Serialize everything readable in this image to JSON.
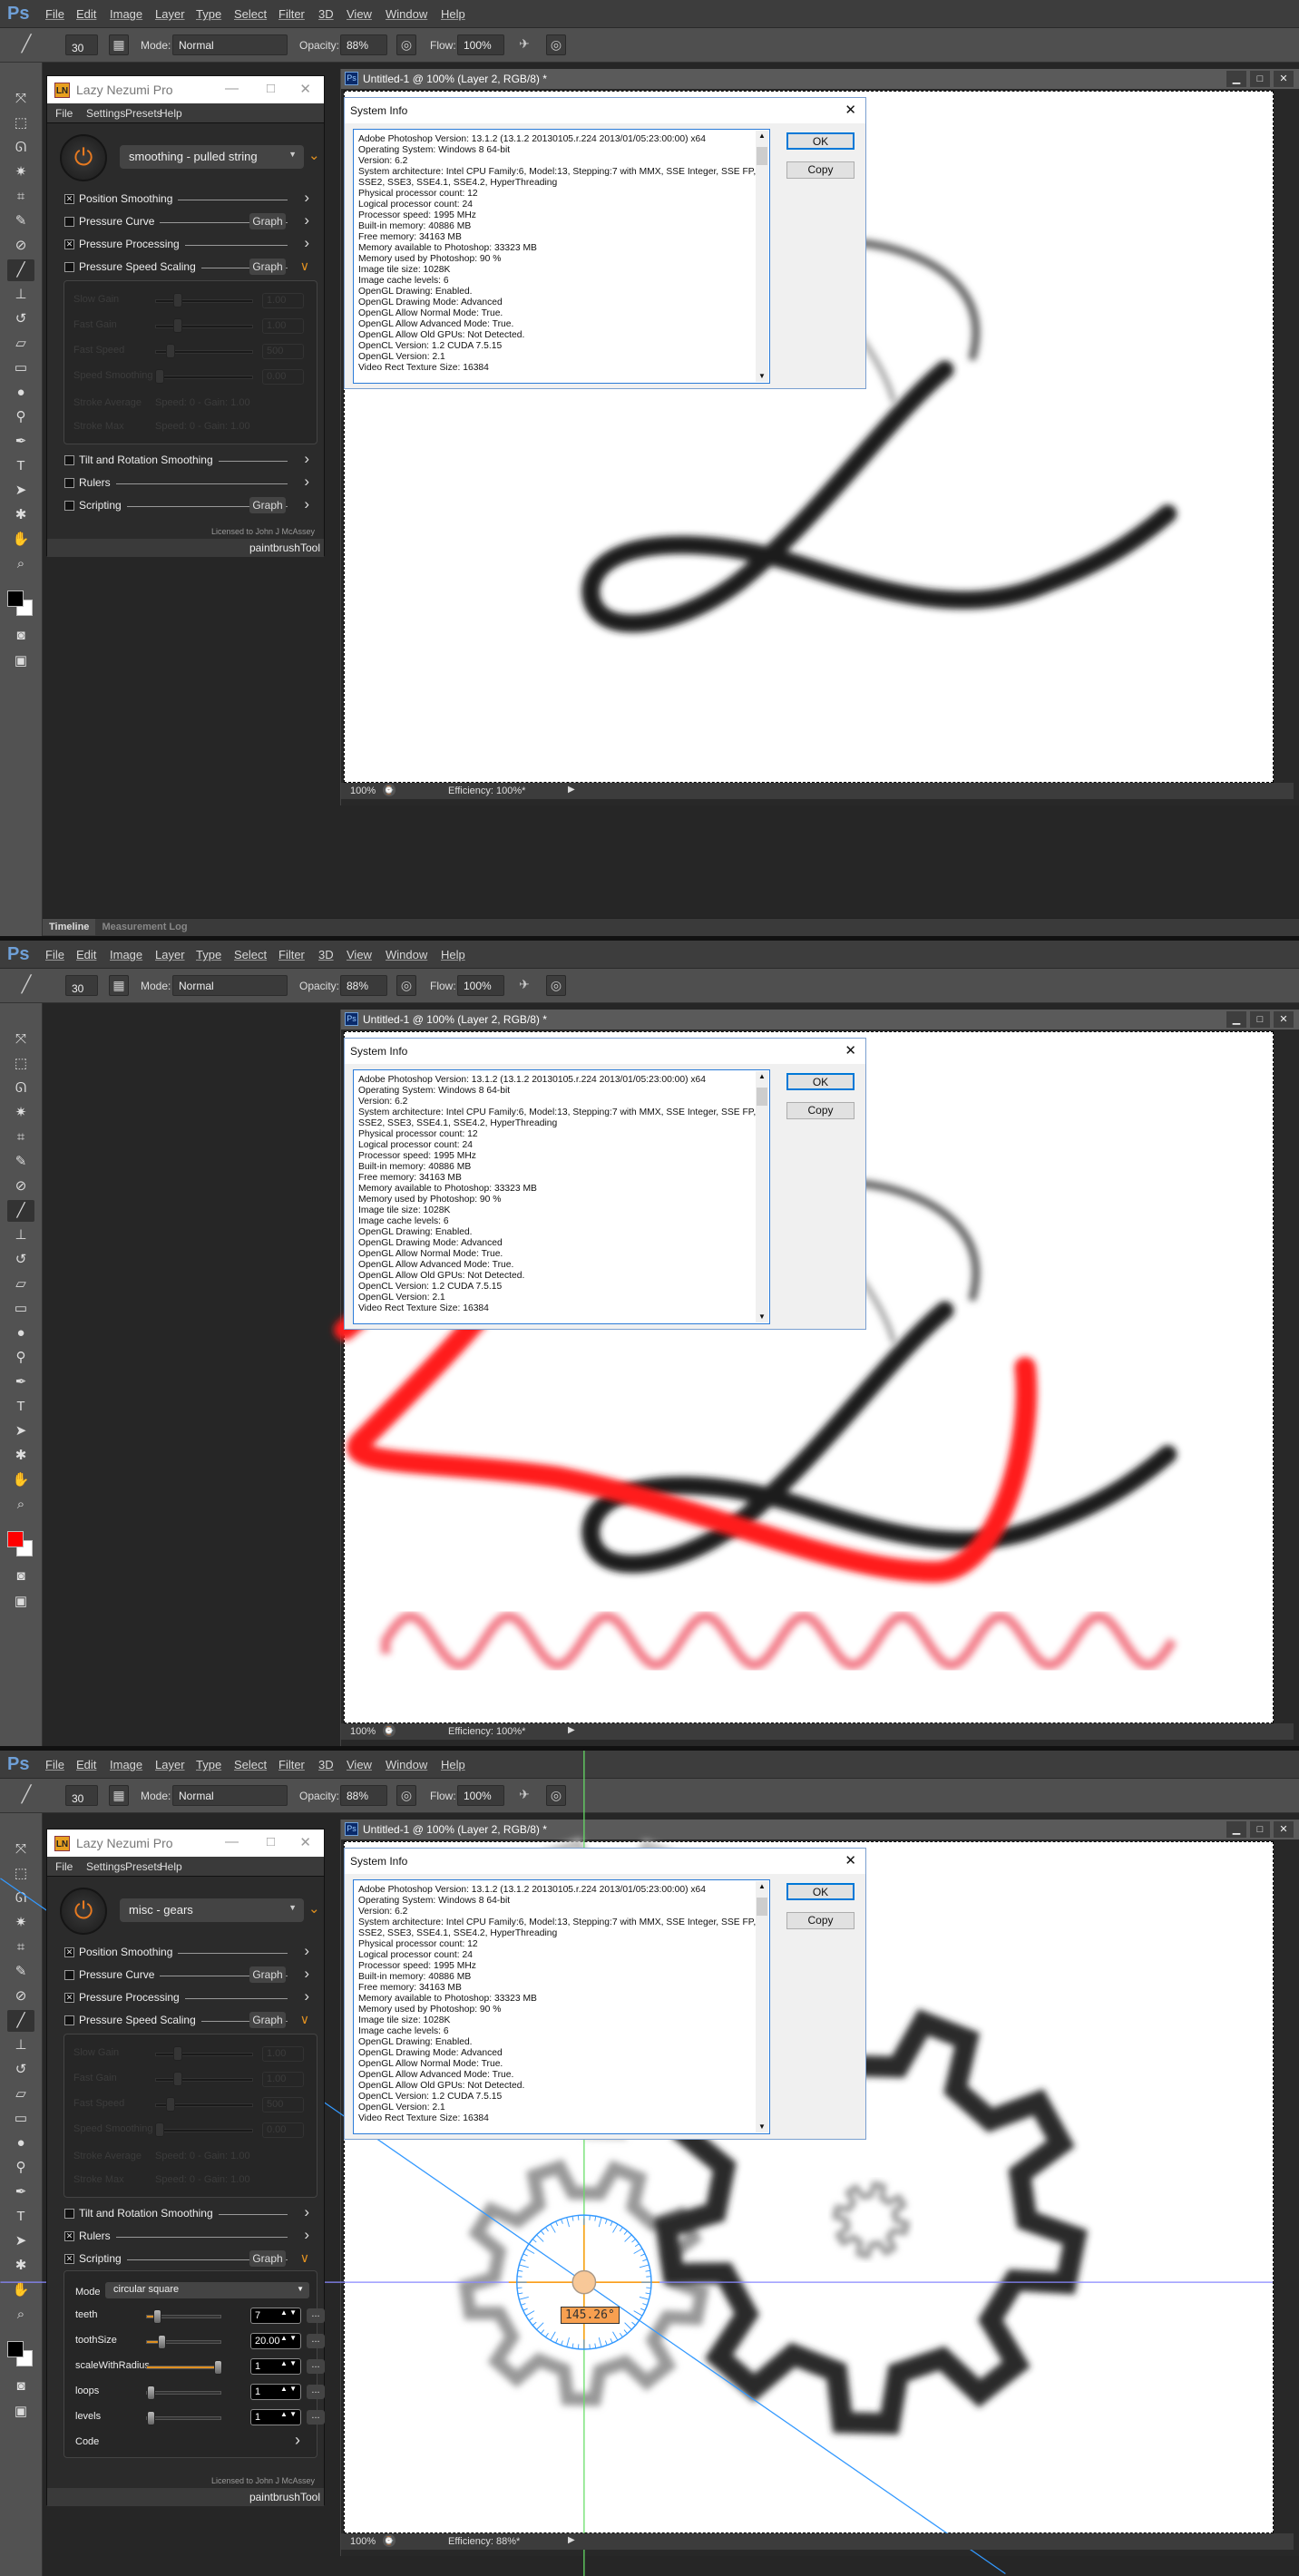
{
  "app": {
    "logo": "Ps",
    "menu": [
      "File",
      "Edit",
      "Image",
      "Layer",
      "Type",
      "Select",
      "Filter",
      "3D",
      "View",
      "Window",
      "Help"
    ]
  },
  "options_bar": {
    "brush_size": "30",
    "mode_label": "Mode:",
    "mode_value": "Normal",
    "opacity_label": "Opacity:",
    "opacity_value": "88%",
    "flow_label": "Flow:",
    "flow_value": "100%"
  },
  "document": {
    "title": "Untitled-1 @ 100% (Layer 2, RGB/8) *",
    "zoom": "100%"
  },
  "system_info": {
    "title": "System Info",
    "ok_label": "OK",
    "copy_label": "Copy",
    "lines": [
      "Adobe Photoshop Version: 13.1.2 (13.1.2 20130105.r.224 2013/01/05:23:00:00) x64",
      "Operating System: Windows 8 64-bit",
      "Version: 6.2",
      "System architecture: Intel CPU Family:6, Model:13, Stepping:7 with MMX, SSE Integer, SSE FP,",
      "SSE2, SSE3, SSE4.1, SSE4.2, HyperThreading",
      "Physical processor count: 12",
      "Logical processor count: 24",
      "Processor speed: 1995 MHz",
      "Built-in memory: 40886 MB",
      "Free memory: 34163 MB",
      "Memory available to Photoshop: 33323 MB",
      "Memory used by Photoshop: 90 %",
      "Image tile size: 1028K",
      "Image cache levels: 6",
      "OpenGL Drawing: Enabled.",
      "OpenGL Drawing Mode: Advanced",
      "OpenGL Allow Normal Mode: True.",
      "OpenGL Allow Advanced Mode: True.",
      "OpenGL Allow Old GPUs: Not Detected.",
      "OpenCL Version: 1.2 CUDA 7.5.15",
      "OpenGL Version: 2.1",
      "Video Rect Texture Size: 16384"
    ]
  },
  "plugin": {
    "title": "Lazy Nezumi Pro",
    "logo": "LN",
    "menu": [
      "File",
      "Settings",
      "Presets",
      "Help"
    ],
    "graph_label": "Graph",
    "license": "Licensed to John J McAssey",
    "footer": "paintbrushTool",
    "pressure_speed_box": {
      "sliders": [
        {
          "label": "Slow Gain",
          "value": "1.00",
          "level": 0.2
        },
        {
          "label": "Fast Gain",
          "value": "1.00",
          "level": 0.2
        },
        {
          "label": "Fast Speed",
          "value": "500",
          "level": 0.12
        },
        {
          "label": "Speed Smoothing",
          "value": "0.00",
          "level": 0
        }
      ],
      "stats": [
        {
          "label": "Stroke Average",
          "value": "Speed: 0 - Gain: 1.00"
        },
        {
          "label": "Stroke Max",
          "value": "Speed: 0 - Gain: 1.00"
        }
      ]
    }
  },
  "frames": [
    {
      "foreground_color": "#000000",
      "efficiency": "Efficiency: 100%*",
      "bottom_tabs": [
        "Timeline",
        "Measurement Log"
      ],
      "plugin": {
        "preset": "smoothing - pulled string",
        "rows": [
          {
            "label": "Position Smoothing",
            "checked": true,
            "graph": false,
            "expanded": false
          },
          {
            "label": "Pressure Curve",
            "checked": false,
            "graph": true,
            "expanded": false
          },
          {
            "label": "Pressure Processing",
            "checked": true,
            "graph": false,
            "expanded": false
          },
          {
            "label": "Pressure Speed Scaling",
            "checked": false,
            "graph": true,
            "expanded": true
          },
          {
            "label": "Tilt and Rotation Smoothing",
            "checked": false,
            "graph": false,
            "expanded": false
          },
          {
            "label": "Rulers",
            "checked": false,
            "graph": false,
            "expanded": false
          },
          {
            "label": "Scripting",
            "checked": false,
            "graph": true,
            "expanded": false
          }
        ]
      }
    },
    {
      "foreground_color": "#ff0000",
      "efficiency": "Efficiency: 100%*"
    },
    {
      "foreground_color": "#000000",
      "efficiency": "Efficiency: 88%*",
      "angle_readout": "145.26°",
      "plugin": {
        "preset": "misc - gears",
        "rows": [
          {
            "label": "Position Smoothing",
            "checked": true,
            "graph": false,
            "expanded": false
          },
          {
            "label": "Pressure Curve",
            "checked": false,
            "graph": true,
            "expanded": false
          },
          {
            "label": "Pressure Processing",
            "checked": true,
            "graph": false,
            "expanded": false
          },
          {
            "label": "Pressure Speed Scaling",
            "checked": false,
            "graph": true,
            "expanded": true
          },
          {
            "label": "Tilt and Rotation Smoothing",
            "checked": false,
            "graph": false,
            "expanded": false
          },
          {
            "label": "Rulers",
            "checked": true,
            "graph": false,
            "expanded": false
          },
          {
            "label": "Scripting",
            "checked": true,
            "graph": true,
            "expanded": true
          }
        ],
        "script": {
          "mode_label": "Mode",
          "mode_value": "circular square",
          "params": [
            {
              "label": "teeth",
              "value": "7",
              "level": 0.1
            },
            {
              "label": "toothSize",
              "value": "20.00",
              "level": 0.16
            },
            {
              "label": "scaleWithRadius",
              "value": "1",
              "level": 1
            },
            {
              "label": "loops",
              "value": "1",
              "level": 0
            },
            {
              "label": "levels",
              "value": "1",
              "level": 0
            }
          ],
          "code_label": "Code"
        }
      }
    }
  ],
  "colors": {
    "accent": "#e09020",
    "stroke_red": "#ff1a1a",
    "guide_blue": "#3399ff",
    "guide_green": "#66dd66"
  }
}
